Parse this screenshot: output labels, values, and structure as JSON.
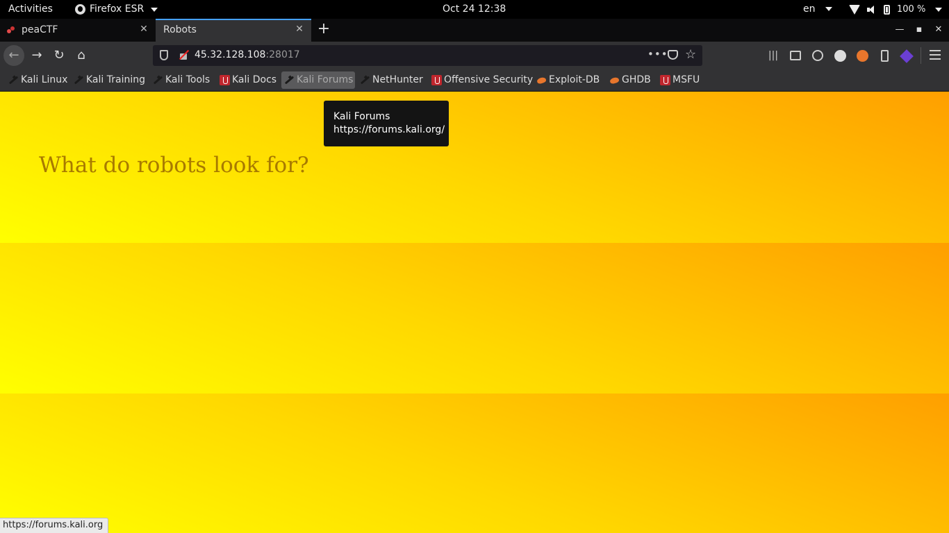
{
  "topbar": {
    "activities": "Activities",
    "app_name": "Firefox ESR",
    "clock": "Oct 24  12:38",
    "language": "en",
    "battery": "100 %"
  },
  "tabs": [
    {
      "label": "peaCTF",
      "active": false
    },
    {
      "label": "Robots",
      "active": true
    }
  ],
  "urlbar": {
    "host": "45.32.128.108",
    "port": ":28017",
    "page_actions": "•••"
  },
  "toolbar_icons": [
    "library-icon",
    "sidebar-icon",
    "account-icon",
    "cookie-icon",
    "ext-orange-icon",
    "ext-phone-icon",
    "ext-purple-icon",
    "menu-icon"
  ],
  "bookmarks": [
    {
      "label": "Kali Linux",
      "icon": "kali-dragon-icon"
    },
    {
      "label": "Kali Training",
      "icon": "kali-dragon-icon"
    },
    {
      "label": "Kali Tools",
      "icon": "kali-dragon-icon"
    },
    {
      "label": "Kali Docs",
      "icon": "kali-docs-icon"
    },
    {
      "label": "Kali Forums",
      "icon": "kali-dragon-icon",
      "hovered": true
    },
    {
      "label": "NetHunter",
      "icon": "kali-dragon-icon"
    },
    {
      "label": "Offensive Security",
      "icon": "offsec-icon"
    },
    {
      "label": "Exploit-DB",
      "icon": "exploitdb-icon"
    },
    {
      "label": "GHDB",
      "icon": "exploitdb-icon"
    },
    {
      "label": "MSFU",
      "icon": "offsec-icon"
    }
  ],
  "tooltip": {
    "title": "Kali Forums",
    "url": "https://forums.kali.org/"
  },
  "page": {
    "heading": "What do robots look for?"
  },
  "statusbar": {
    "url": "https://forums.kali.org"
  },
  "colors": {
    "page_gradient_start": "#ffff00",
    "page_gradient_end": "#ff9f00",
    "heading_color": "#a87a00",
    "active_tab_accent": "#45a1ff"
  }
}
